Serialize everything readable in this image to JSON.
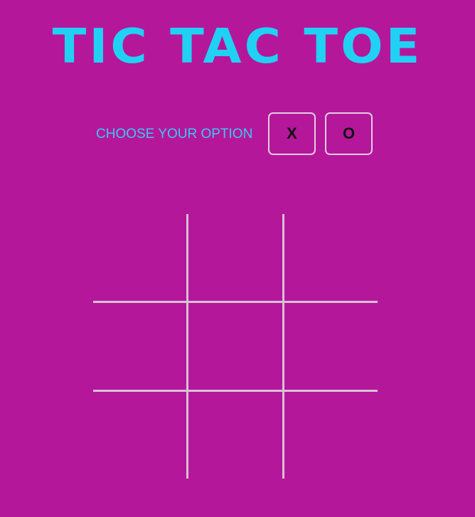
{
  "title": "TIC TAC TOE",
  "chooser": {
    "label": "CHOOSE YOUR OPTION",
    "options": [
      "X",
      "O"
    ]
  },
  "board": {
    "cells": [
      "",
      "",
      "",
      "",
      "",
      "",
      "",
      "",
      ""
    ]
  },
  "colors": {
    "background": "#b5179a",
    "title": "#21d1f4",
    "label": "#3cc8f5",
    "grid": "#d6c3d3"
  }
}
